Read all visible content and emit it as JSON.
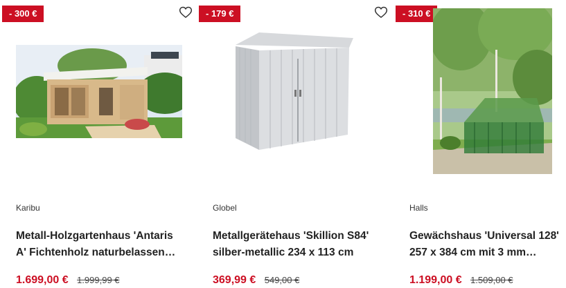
{
  "products": [
    {
      "discount": "- 300 €",
      "brand": "Karibu",
      "title_line1": "Metall-Holzgartenhaus 'Antaris",
      "title_line2": "A' Fichtenholz naturbelassen…",
      "price": "1.699,00 €",
      "old_price": "1.999,99 €"
    },
    {
      "discount": "- 179 €",
      "brand": "Globel",
      "title_line1": "Metallgerätehaus 'Skillion S84'",
      "title_line2": "silber-metallic 234 x 113 cm",
      "price": "369,99 €",
      "old_price": "549,00 €"
    },
    {
      "discount": "- 310 €",
      "brand": "Halls",
      "title_line1": "Gewächshaus 'Universal 128'",
      "title_line2": "257 x 384 cm mit 3 mm…",
      "price": "1.199,00 €",
      "old_price": "1.509,00 €"
    }
  ],
  "icons": {
    "favorite": "heart-outline-icon"
  },
  "colors": {
    "accent": "#cc0f23"
  }
}
